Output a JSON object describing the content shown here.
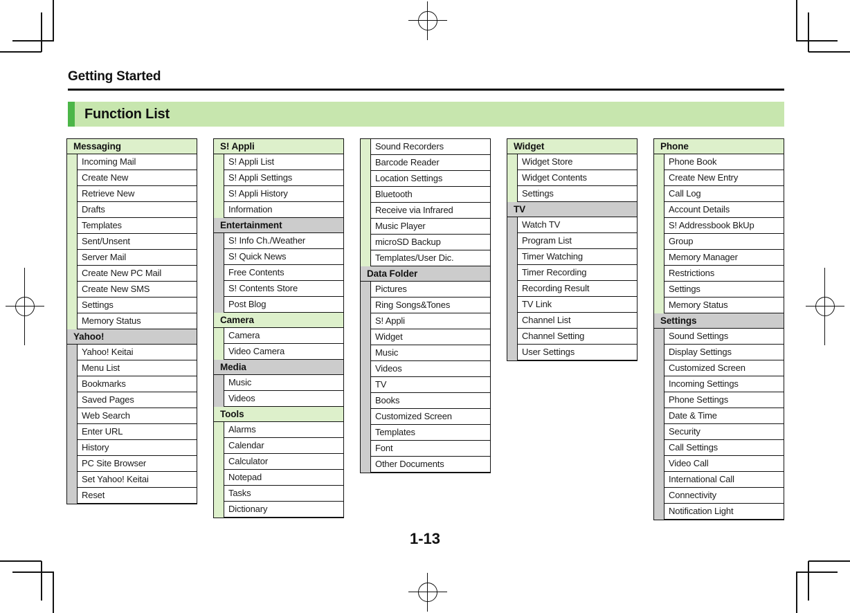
{
  "page": {
    "chapter_title": "Getting Started",
    "section_title": "Function List",
    "page_number": "1-13",
    "colors": {
      "accent_bar": "#4cb648",
      "banner_bg": "#c7e6ae",
      "group_green": "#ddf0cb",
      "group_gray": "#cccccc",
      "rule": "#111111"
    }
  },
  "columns": [
    {
      "groups": [
        {
          "header": "Messaging",
          "tone": "green",
          "items": [
            "Incoming Mail",
            "Create New",
            "Retrieve New",
            "Drafts",
            "Templates",
            "Sent/Unsent",
            "Server Mail",
            "Create New PC Mail",
            "Create New SMS",
            "Settings",
            "Memory Status"
          ]
        },
        {
          "header": "Yahoo!",
          "tone": "gray",
          "items": [
            "Yahoo! Keitai",
            "Menu List",
            "Bookmarks",
            "Saved Pages",
            "Web Search",
            "Enter URL",
            "History",
            "PC Site Browser",
            "Set Yahoo! Keitai",
            "Reset"
          ]
        }
      ]
    },
    {
      "groups": [
        {
          "header": "S! Appli",
          "tone": "green",
          "items": [
            "S! Appli List",
            "S! Appli Settings",
            "S! Appli History",
            "Information"
          ]
        },
        {
          "header": "Entertainment",
          "tone": "gray",
          "items": [
            "S! Info Ch./Weather",
            "S! Quick News",
            "Free Contents",
            "S! Contents Store",
            "Post Blog"
          ]
        },
        {
          "header": "Camera",
          "tone": "green",
          "items": [
            "Camera",
            "Video Camera"
          ]
        },
        {
          "header": "Media",
          "tone": "gray",
          "items": [
            "Music",
            "Videos"
          ]
        },
        {
          "header": "Tools",
          "tone": "green",
          "items": [
            "Alarms",
            "Calendar",
            "Calculator",
            "Notepad",
            "Tasks",
            "Dictionary"
          ]
        }
      ]
    },
    {
      "groups": [
        {
          "header": null,
          "tone": "green",
          "items": [
            "Sound Recorders",
            "Barcode Reader",
            "Location Settings",
            "Bluetooth",
            "Receive via Infrared",
            "Music Player",
            "microSD Backup",
            "Templates/User Dic."
          ]
        },
        {
          "header": "Data Folder",
          "tone": "gray",
          "items": [
            "Pictures",
            "Ring Songs&Tones",
            "S! Appli",
            "Widget",
            "Music",
            "Videos",
            "TV",
            "Books",
            "Customized Screen",
            "Templates",
            "Font",
            "Other Documents"
          ]
        }
      ]
    },
    {
      "groups": [
        {
          "header": "Widget",
          "tone": "green",
          "items": [
            "Widget Store",
            "Widget Contents",
            "Settings"
          ]
        },
        {
          "header": "TV",
          "tone": "gray",
          "items": [
            "Watch TV",
            "Program List",
            "Timer Watching",
            "Timer Recording",
            "Recording Result",
            "TV Link",
            "Channel List",
            "Channel Setting",
            "User Settings"
          ]
        }
      ]
    },
    {
      "groups": [
        {
          "header": "Phone",
          "tone": "green",
          "items": [
            "Phone Book",
            "Create New Entry",
            "Call Log",
            "Account Details",
            "S! Addressbook BkUp",
            "Group",
            "Memory Manager",
            "Restrictions",
            "Settings",
            "Memory Status"
          ]
        },
        {
          "header": "Settings",
          "tone": "gray",
          "items": [
            "Sound Settings",
            "Display Settings",
            "Customized Screen",
            "Incoming Settings",
            "Phone Settings",
            "Date & Time",
            "Security",
            "Call Settings",
            "Video Call",
            "International Call",
            "Connectivity",
            "Notification Light"
          ]
        }
      ]
    }
  ]
}
